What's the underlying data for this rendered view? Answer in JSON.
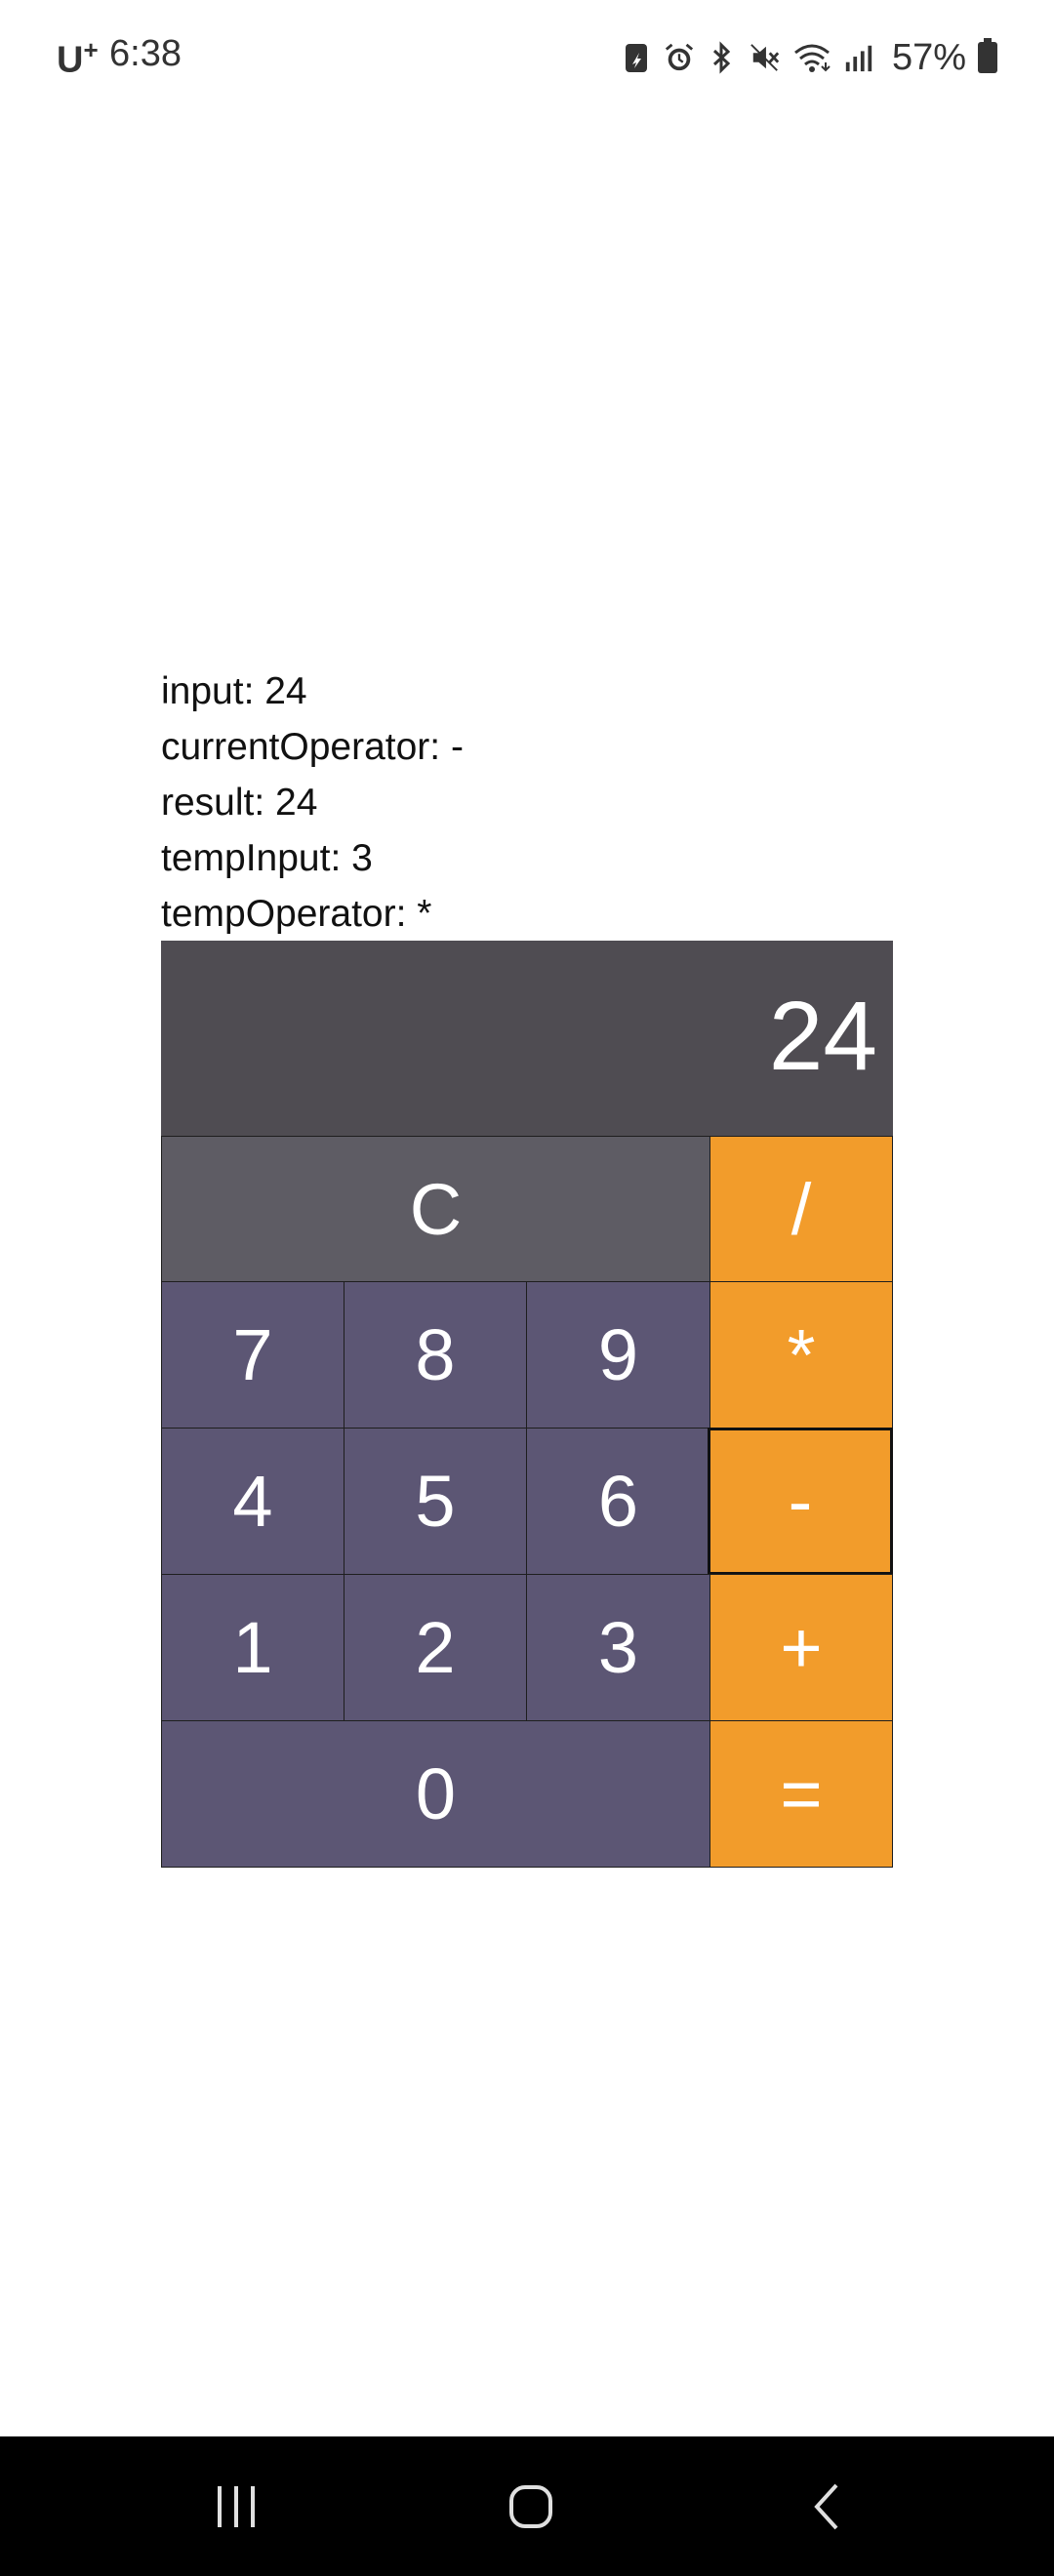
{
  "status_bar": {
    "carrier": "U",
    "carrier_sup": "+",
    "time": "6:38",
    "battery_percent": "57%",
    "icons": [
      "battery-saver-icon",
      "alarm-icon",
      "bluetooth-icon",
      "mute-icon",
      "wifi-icon",
      "signal-icon",
      "battery-icon"
    ]
  },
  "debug": {
    "input": "input: 24",
    "current_operator": "currentOperator: -",
    "result": "result: 24",
    "temp_input": "tempInput: 3",
    "temp_operator": "tempOperator: *"
  },
  "calculator": {
    "display": "24",
    "keys": {
      "clear": "C",
      "divide": "/",
      "seven": "7",
      "eight": "8",
      "nine": "9",
      "multiply": "*",
      "four": "4",
      "five": "5",
      "six": "6",
      "minus": "-",
      "one": "1",
      "two": "2",
      "three": "3",
      "plus": "+",
      "zero": "0",
      "equals": "="
    },
    "active_operator": "-",
    "colors": {
      "display_bg": "#4f4c52",
      "clear_bg": "#5e5c64",
      "number_bg": "#5c5674",
      "operator_bg": "#f29c2b"
    }
  },
  "nav_bar": {
    "icons": [
      "recent-apps-icon",
      "home-icon",
      "back-icon"
    ]
  }
}
